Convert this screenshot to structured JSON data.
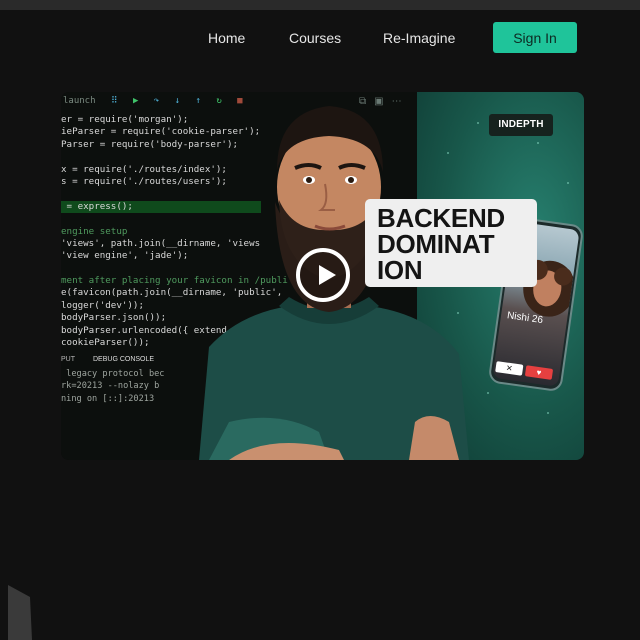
{
  "nav": {
    "home": "Home",
    "courses": "Courses",
    "reimagine": "Re-Imagine",
    "signin": "Sign In"
  },
  "video": {
    "badge": "INDEPTH",
    "title_lines": [
      "BACKEND",
      "DOMINAT",
      "ION"
    ],
    "play_icon": "play-icon",
    "editor": {
      "toolbar_label": "launch",
      "code_lines": [
        "er = require('morgan');",
        "ieParser = require('cookie-parser');",
        "Parser = require('body-parser');",
        "",
        "x = require('./routes/index');",
        "s = require('./routes/users');",
        "",
        " = express();",
        "",
        "engine setup",
        "'views', path.join(__dirname, 'views",
        "'view engine', 'jade');",
        "",
        "ment after placing your favicon in /publi",
        "e(favicon(path.join(__dirname, 'public',",
        "logger('dev'));",
        "bodyParser.json());",
        "bodyParser.urlencoded({ extend",
        "cookieParser());"
      ],
      "console_tabs": [
        "PUT",
        "DEBUG CONSOLE"
      ],
      "console_lines": [
        " legacy protocol bec",
        "rk=20213 --nolazy b",
        "ning on [::]:20213"
      ]
    },
    "phone": {
      "profile_name": "Nishi 26",
      "reject_icon": "close-icon",
      "like_icon": "heart-icon"
    }
  },
  "colors": {
    "background": "#111111",
    "accent": "#1fc49a",
    "video_green": "#18574a"
  }
}
